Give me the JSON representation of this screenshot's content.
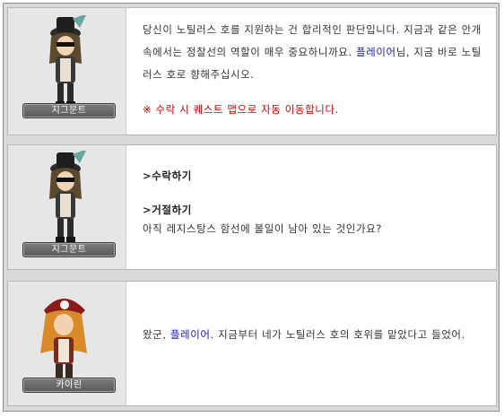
{
  "panels": [
    {
      "npc_name": "지그문트",
      "text_part1": "당신이 노틸러스 호를 지원하는 건 합리적인 판단입니다. 지금과 같은 안개 속에서는 정찰선의 역할이 매우 중요하니까요. ",
      "player_name": "플레이어",
      "text_part2": "님, 지금 바로 노틸러스 호로 향해주십시오.",
      "warning": "※ 수락 시 퀘스트 맵으로 자동 이동합니다."
    },
    {
      "npc_name": "지그문트",
      "option_accept": ">수락하기",
      "option_decline": ">거절하기",
      "decline_text": "아직 레지스탕스 함선에 볼일이 남아 있는 것인가요?"
    },
    {
      "npc_name": "카이린",
      "text_part1": "왔군, ",
      "player_name": "플레이어",
      "text_part2": ". 지금부터 네가 노틸러스 호의 호위를 맡았다고 들었어."
    }
  ],
  "colors": {
    "highlight": "#1a1aa6",
    "warning": "#cc0000",
    "background": "#d9d9d9"
  }
}
